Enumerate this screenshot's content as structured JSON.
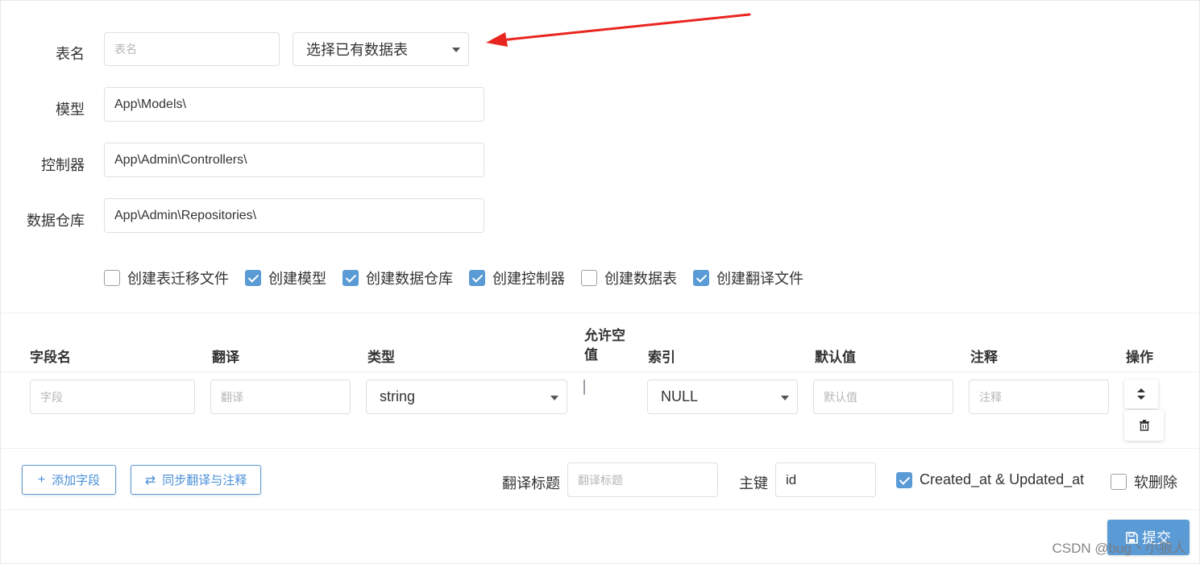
{
  "form": {
    "table_name_label": "表名",
    "table_name_placeholder": "表名",
    "table_select_value": "选择已有数据表",
    "model_label": "模型",
    "model_value": "App\\Models\\",
    "controller_label": "控制器",
    "controller_value": "App\\Admin\\Controllers\\",
    "repository_label": "数据仓库",
    "repository_value": "App\\Admin\\Repositories\\"
  },
  "options": [
    {
      "label": "创建表迁移文件",
      "checked": false
    },
    {
      "label": "创建模型",
      "checked": true
    },
    {
      "label": "创建数据仓库",
      "checked": true
    },
    {
      "label": "创建控制器",
      "checked": true
    },
    {
      "label": "创建数据表",
      "checked": false
    },
    {
      "label": "创建翻译文件",
      "checked": true
    }
  ],
  "fields_table": {
    "headers": {
      "field_name": "字段名",
      "translation": "翻译",
      "type": "类型",
      "nullable_line1": "允许空",
      "nullable_line2": "值",
      "index": "索引",
      "default": "默认值",
      "comment": "注释",
      "actions": "操作"
    },
    "row": {
      "field_placeholder": "字段",
      "translation_placeholder": "翻译",
      "type_value": "string",
      "nullable": false,
      "index_value": "NULL",
      "default_placeholder": "默认值",
      "comment_placeholder": "注释",
      "sort_icon": "sort-icon",
      "delete_icon": "trash-icon"
    }
  },
  "footer": {
    "add_field_label": "添加字段",
    "sync_label": "同步翻译与注释",
    "title_label": "翻译标题",
    "title_placeholder": "翻译标题",
    "primary_key_label": "主键",
    "primary_key_value": "id",
    "timestamps_label": "Created_at & Updated_at",
    "timestamps_checked": true,
    "soft_delete_label": "软删除",
    "soft_delete_checked": false,
    "submit_label": "提交"
  },
  "watermark": "CSDN @bug丶小狼人",
  "colors": {
    "accent": "#5b9bd5",
    "arrow": "#e8261f"
  }
}
